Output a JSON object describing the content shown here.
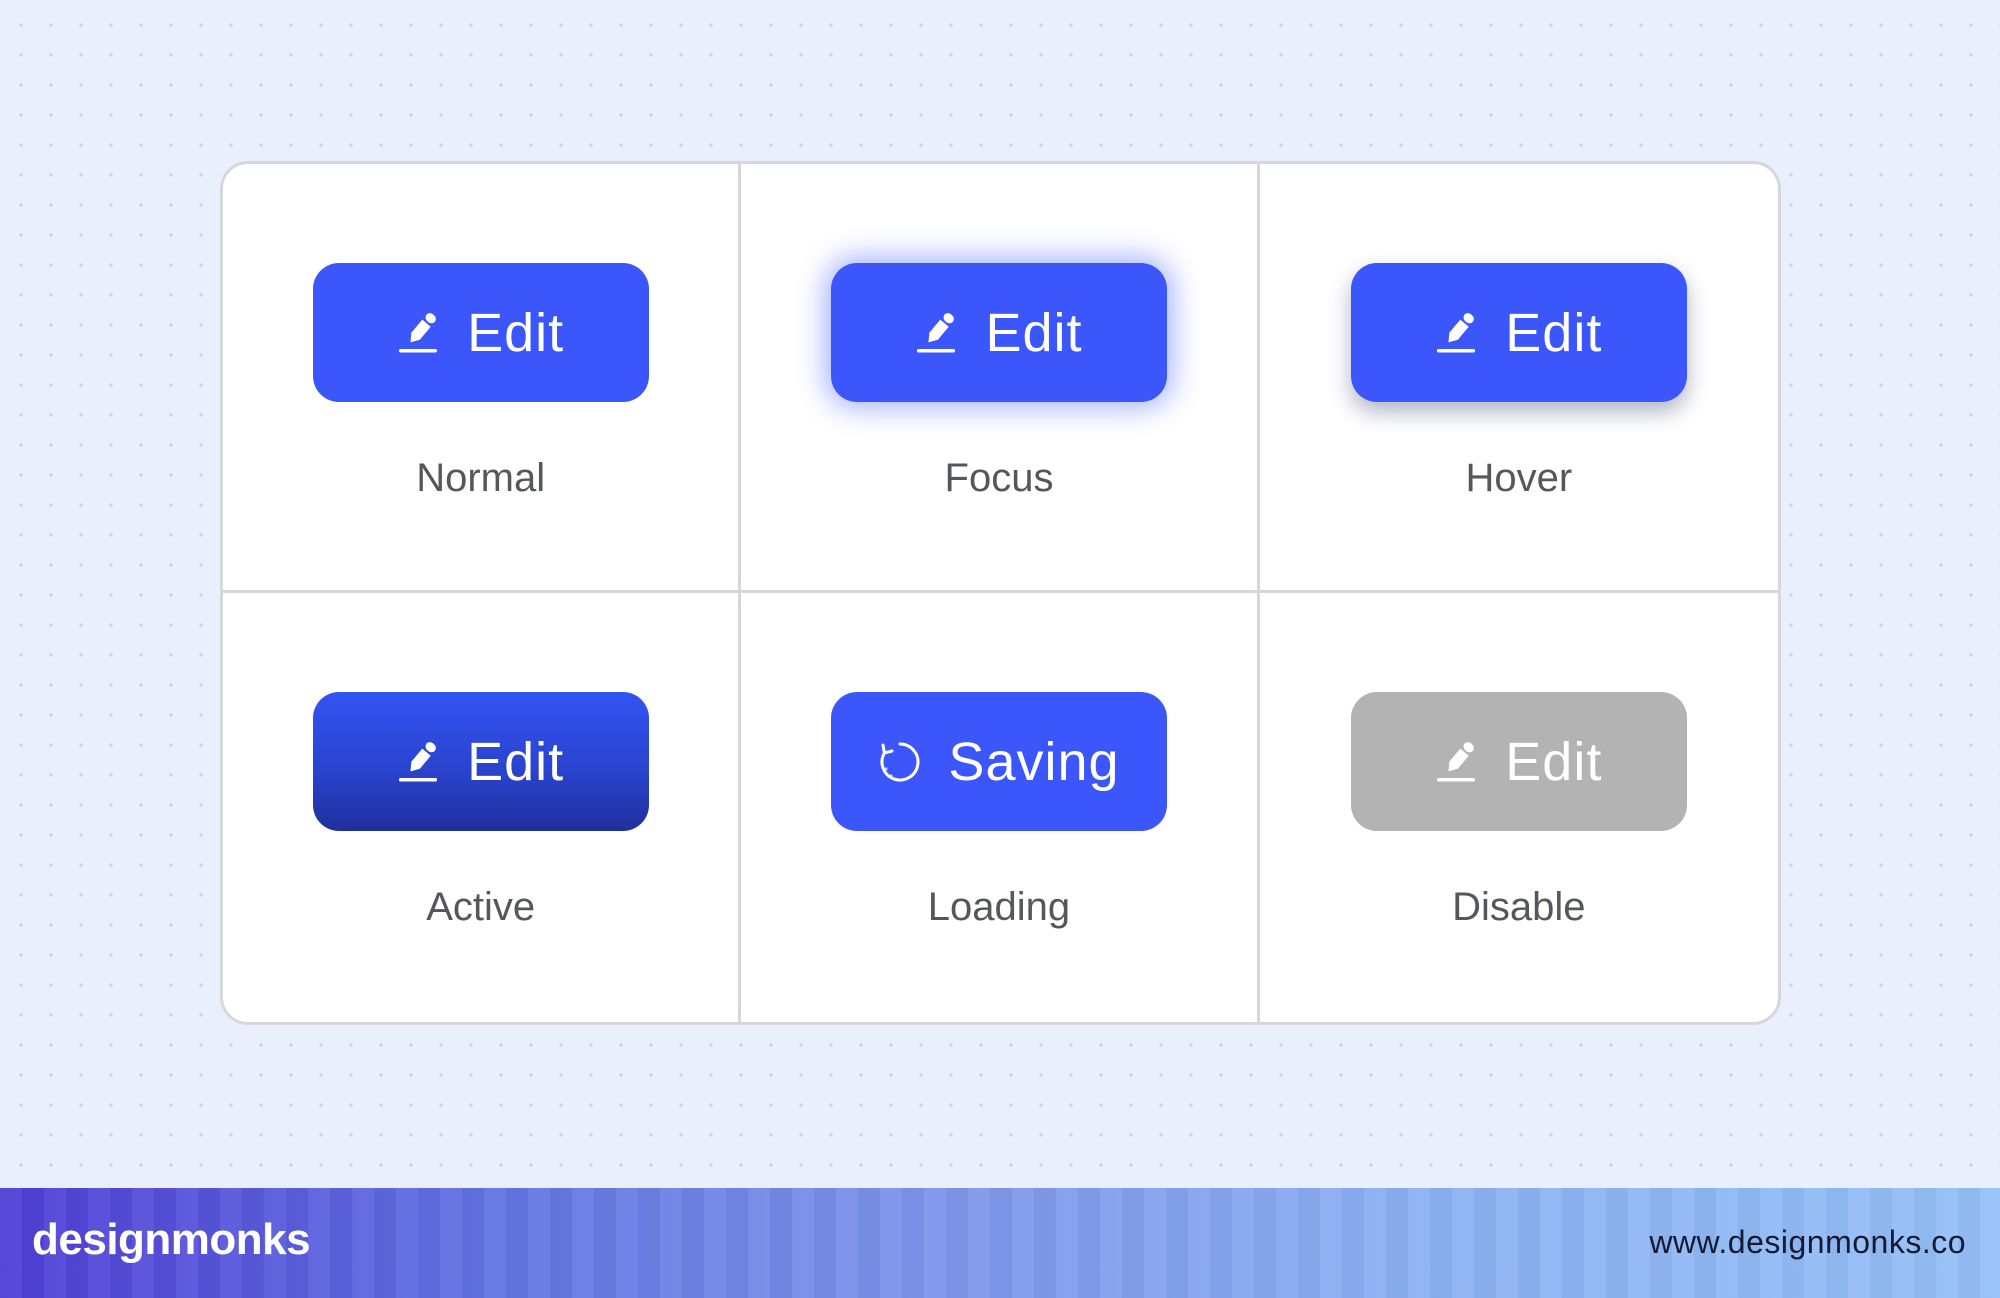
{
  "states": [
    {
      "button_label": "Edit",
      "icon": "pencil-icon",
      "state_label": "Normal"
    },
    {
      "button_label": "Edit",
      "icon": "pencil-icon",
      "state_label": "Focus"
    },
    {
      "button_label": "Edit",
      "icon": "pencil-icon",
      "state_label": "Hover"
    },
    {
      "button_label": "Edit",
      "icon": "pencil-icon",
      "state_label": "Active"
    },
    {
      "button_label": "Saving",
      "icon": "spinner-icon",
      "state_label": "Loading"
    },
    {
      "button_label": "Edit",
      "icon": "pencil-icon",
      "state_label": "Disable"
    }
  ],
  "colors": {
    "primary": "#3b56fb",
    "active": "#2a44cf",
    "disabled": "#b3b3b3",
    "label_text": "#55575c"
  },
  "footer": {
    "brand": "designmonks",
    "url": "www.designmonks.co"
  }
}
